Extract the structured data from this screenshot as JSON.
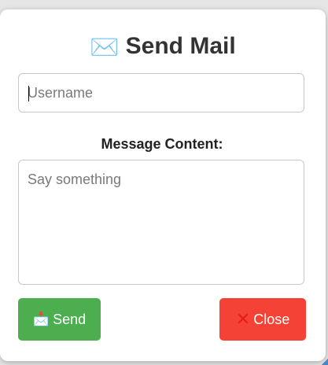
{
  "dialog": {
    "title_icon": "envelope-icon",
    "title_glyph": "✉️",
    "title": "Send Mail"
  },
  "form": {
    "username_placeholder": "Username",
    "username_value": "",
    "message_label": "Message Content:",
    "message_placeholder": "Say something",
    "message_value": ""
  },
  "buttons": {
    "send_icon": "inbox-tray-icon",
    "send_glyph": "📩",
    "send_label": "Send",
    "close_icon": "cross-mark-icon",
    "close_glyph": "✕",
    "close_label": "Close"
  },
  "colors": {
    "send_bg": "#4cae4f",
    "close_bg": "#f44336"
  }
}
